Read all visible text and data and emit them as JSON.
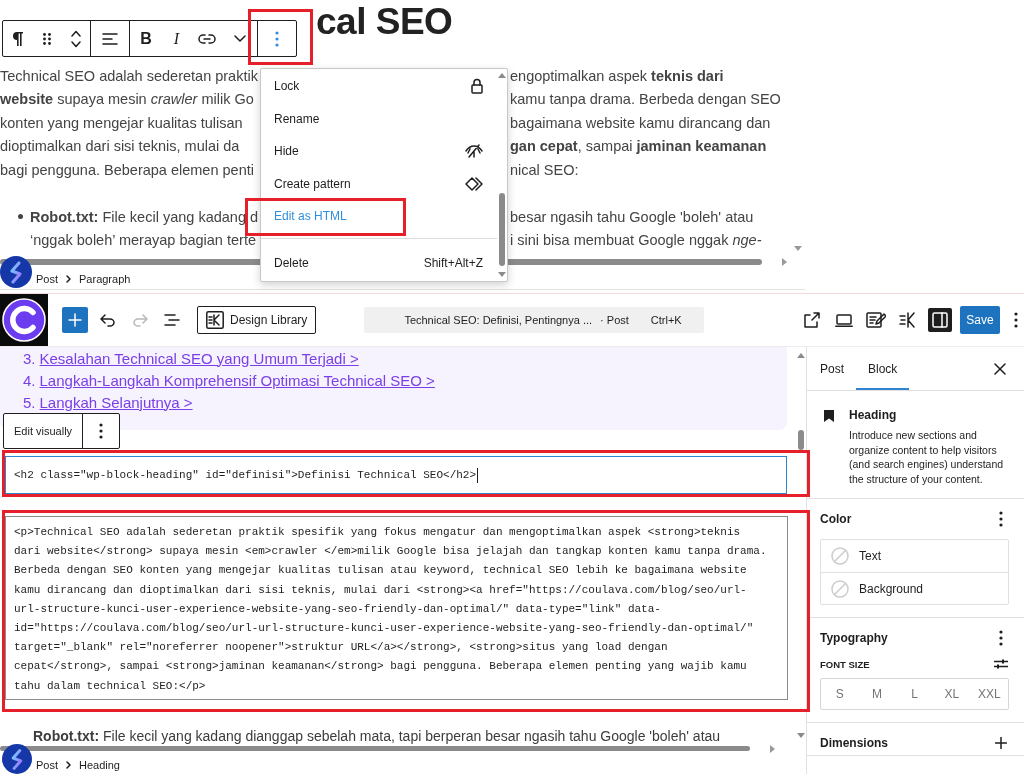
{
  "top_screenshot": {
    "heading": "cal SEO",
    "block_toolbar": {
      "groups": [
        {
          "buttons": [
            {
              "kind": "paragraph",
              "pressed": false,
              "highlighted": false
            },
            {
              "kind": "drag",
              "pressed": false,
              "highlighted": false
            },
            {
              "kind": "move",
              "pressed": false,
              "highlighted": false
            }
          ]
        },
        {
          "buttons": [
            {
              "kind": "align",
              "pressed": false,
              "highlighted": false
            }
          ]
        },
        {
          "buttons": [
            {
              "kind": "bold",
              "label": "B",
              "pressed": false,
              "highlighted": false
            },
            {
              "kind": "italic",
              "label": "I",
              "pressed": false,
              "highlighted": false
            },
            {
              "kind": "link",
              "pressed": false,
              "highlighted": false
            },
            {
              "kind": "more_formats",
              "pressed": false,
              "highlighted": false
            }
          ]
        },
        {
          "buttons": [
            {
              "kind": "options",
              "pressed": true,
              "highlighted": true
            }
          ]
        }
      ]
    },
    "paragraph_lines": [
      {
        "left": "Technical SEO adalah sederetan praktik",
        "right": "engoptimalkan aspek **teknis dari**"
      },
      {
        "left": "**website** supaya mesin *crawler* milik Go",
        "right": "kamu tanpa drama. Berbeda dengan SEO"
      },
      {
        "left": "konten yang mengejar kualitas tulisan",
        "right": "bagaimana website kamu dirancang dan"
      },
      {
        "left": "dioptimalkan dari sisi teknis, mulai da",
        "right": "**gan cepat**, sampai **jaminan keamanan**"
      },
      {
        "left": "bagi pengguna. Beberapa elemen penti",
        "right": "nical SEO:"
      }
    ],
    "list_lines": [
      {
        "left": "**Robot.txt:** File kecil yang kadang d",
        "right": "besar ngasih tahu Google 'boleh' atau",
        "bullet": true
      },
      {
        "left": "‘nggak boleh’ merayap bagian terte",
        "right": "i sini bisa membuat Google nggak *nge-*",
        "bullet": false
      }
    ],
    "options_menu": {
      "items": [
        {
          "label": "Lock",
          "kind": "lock",
          "selected": false,
          "highlighted": false,
          "divider_before": false
        },
        {
          "label": "Rename",
          "kind": "text",
          "selected": false,
          "highlighted": false,
          "divider_before": false
        },
        {
          "label": "Hide",
          "kind": "hide",
          "selected": false,
          "highlighted": false,
          "divider_before": false
        },
        {
          "label": "Create pattern",
          "kind": "pattern",
          "selected": false,
          "highlighted": false,
          "divider_before": false
        },
        {
          "label": "Edit as HTML",
          "kind": "text",
          "selected": true,
          "highlighted": true,
          "divider_before": false
        },
        {
          "label": "Delete",
          "kind": "text",
          "shortcut": "Shift+Alt+Z",
          "selected": false,
          "highlighted": false,
          "divider_before": true
        }
      ]
    },
    "breadcrumb": [
      "Post",
      "Paragraph"
    ]
  },
  "editor": {
    "toolbar": {
      "history": [
        {
          "kind": "undo",
          "disabled": false
        },
        {
          "kind": "redo",
          "disabled": true
        }
      ],
      "design_library": "Design Library",
      "command_bar": {
        "title": "Technical SEO: Definisi, Pentingnya ...",
        "post_type": "· Post",
        "shortcut": "Ctrl+K"
      },
      "settings_open": true,
      "save": "Save"
    },
    "toc_items": [
      {
        "number": "3.",
        "label": "Kesalahan Technical SEO yang Umum Terjadi >"
      },
      {
        "number": "4.",
        "label": "Langkah-Langkah Komprehensif Optimasi Technical SEO >"
      },
      {
        "number": "5.",
        "label": "Langkah Selanjutnya >"
      }
    ],
    "block_toolbar": {
      "label": "Edit visually"
    },
    "html_blocks": [
      {
        "kind": "heading",
        "code": "<h2 class=\"wp-block-heading\" id=\"definisi\">Definisi Technical SEO</h2>",
        "focused": true,
        "highlighted": true
      },
      {
        "kind": "paragraph",
        "code": "<p>Technical SEO adalah sederetan praktik spesifik yang fokus mengatur dan mengoptimalkan aspek <strong>teknis dari website</strong> supaya mesin <em>crawler </em>milik Google bisa jelajah dan tangkap konten kamu tanpa drama. Berbeda dengan SEO konten yang mengejar kualitas tulisan atau keyword, technical SEO lebih ke bagaimana website kamu dirancang dan dioptimalkan dari sisi teknis, mulai dari <strong><a href=\"https://coulava.com/blog/seo/url-url-structure-kunci-user-experience-website-yang-seo-friendly-dan-optimal/\" data-type=\"link\" data-id=\"https://coulava.com/blog/seo/url-url-structure-kunci-user-experience-website-yang-seo-friendly-dan-optimal/\" target=\"_blank\" rel=\"noreferrer noopener\">struktur URL</a></strong>, <strong>situs yang load dengan cepat</strong>, sampai <strong>jaminan keamanan</strong> bagi pengguna. Beberapa elemen penting yang wajib kamu tahu dalam technical SEO:</p>",
        "focused": false,
        "highlighted": true
      }
    ],
    "list_line": "**Robot.txt:** File kecil yang kadang dianggap sebelah mata, tapi berperan besar ngasih tahu Google 'boleh' atau",
    "breadcrumb": [
      "Post",
      "Heading"
    ]
  },
  "sidebar": {
    "tabs": [
      {
        "label": "Post",
        "selected": false
      },
      {
        "label": "Block",
        "selected": true
      }
    ],
    "block_card": {
      "title": "Heading",
      "description": "Introduce new sections and organize content to help visitors (and search engines) understand the structure of your content."
    },
    "color_panel": {
      "title": "Color",
      "items": [
        "Text",
        "Background"
      ]
    },
    "typography_panel": {
      "title": "Typography",
      "font_size_label": "FONT SIZE",
      "sizes": [
        {
          "label": "S",
          "selected": false
        },
        {
          "label": "M",
          "selected": false
        },
        {
          "label": "L",
          "selected": false
        },
        {
          "label": "XL",
          "selected": false
        },
        {
          "label": "XXL",
          "selected": false
        }
      ]
    },
    "dimensions_panel": {
      "title": "Dimensions"
    }
  }
}
